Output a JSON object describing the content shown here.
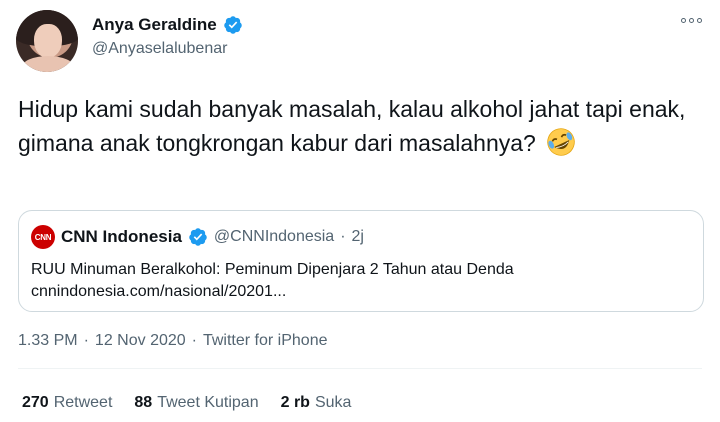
{
  "author": {
    "display_name": "Anya Geraldine",
    "handle": "@Anyaselalubenar",
    "verified": true
  },
  "tweet": {
    "text": "Hidup kami sudah banyak masalah, kalau alkohol jahat tapi enak, gimana anak tongkrongan kabur dari masalahnya?",
    "emoji": "rolling-on-the-floor-laughing"
  },
  "quote": {
    "logo_text": "CNN",
    "name": "CNN Indonesia",
    "handle": "@CNNIndonesia",
    "separator": "·",
    "time": "2j",
    "headline": "RUU Minuman Beralkohol: Peminum Dipenjara 2 Tahun atau Denda",
    "link": "cnnindonesia.com/nasional/20201..."
  },
  "meta": {
    "time": "1.33 PM",
    "sep1": "·",
    "date": "12 Nov 2020",
    "sep2": "·",
    "source": "Twitter for iPhone"
  },
  "stats": {
    "retweets": {
      "count": "270",
      "label": "Retweet"
    },
    "quotes": {
      "count": "88",
      "label": "Tweet Kutipan"
    },
    "likes": {
      "count": "2 rb",
      "label": "Suka"
    }
  },
  "colors": {
    "verified_blue": "#1d9bf0",
    "cnn_red": "#cc0000",
    "secondary_text": "#536471"
  }
}
